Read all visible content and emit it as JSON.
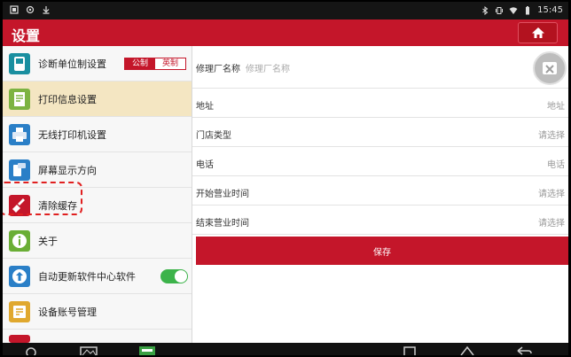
{
  "status_bar": {
    "time": "15:45",
    "icons": [
      "screenshot-icon",
      "settings-notification-icon",
      "download-icon",
      "bluetooth-icon",
      "vibrate-icon",
      "wifi-icon",
      "battery-icon"
    ]
  },
  "header": {
    "title": "设置",
    "home_icon": "home-icon"
  },
  "sidebar": {
    "items": [
      {
        "label": "诊断单位制设置",
        "icon": "diagnostic-unit-icon",
        "color": "#1a8fa0"
      },
      {
        "label": "打印信息设置",
        "icon": "print-info-icon",
        "color": "#7cb342"
      },
      {
        "label": "无线打印机设置",
        "icon": "wireless-printer-icon",
        "color": "#2a7fc7"
      },
      {
        "label": "屏幕显示方向",
        "icon": "screen-orientation-icon",
        "color": "#2a7fc7"
      },
      {
        "label": "清除缓存",
        "icon": "clear-cache-icon",
        "color": "#c4162a"
      },
      {
        "label": "关于",
        "icon": "info-icon",
        "color": "#6aae35"
      },
      {
        "label": "自动更新软件中心软件",
        "icon": "auto-update-icon",
        "color": "#2a7fc7"
      },
      {
        "label": "设备账号管理",
        "icon": "account-manage-icon",
        "color": "#e0a82e"
      }
    ],
    "unit_toggle": {
      "metric": "公制",
      "imperial": "英制"
    },
    "auto_update_enabled": true
  },
  "form": {
    "shop_name_label": "修理厂名称",
    "shop_name_placeholder": "修理厂名称",
    "rows": [
      {
        "label": "地址",
        "value": "地址"
      },
      {
        "label": "门店类型",
        "value": "请选择"
      },
      {
        "label": "电话",
        "value": "电话"
      },
      {
        "label": "开始营业时间",
        "value": "请选择"
      },
      {
        "label": "结束营业时间",
        "value": "请选择"
      }
    ],
    "save_label": "保存"
  },
  "colors": {
    "brand_red": "#c4162a",
    "active_item": "#f4e6c2",
    "toggle_green": "#3cb34a"
  }
}
